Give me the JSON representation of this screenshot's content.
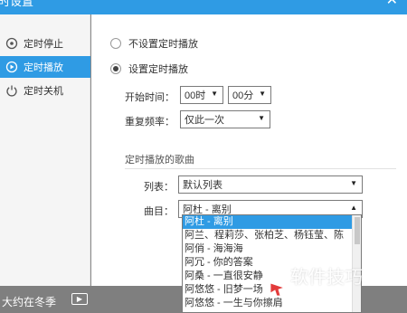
{
  "window": {
    "title": "时设置",
    "close_glyph": "✕"
  },
  "sidebar": {
    "items": [
      {
        "label": "定时停止",
        "icon": "timer-stop-icon",
        "active": false
      },
      {
        "label": "定时播放",
        "icon": "timer-play-icon",
        "active": true
      },
      {
        "label": "定时关机",
        "icon": "power-icon",
        "active": false
      }
    ]
  },
  "main": {
    "radio_no_schedule": "不设置定时播放",
    "radio_schedule": "设置定时播放",
    "start_time_label": "开始时间：",
    "hour_value": "00时",
    "minute_value": "00分",
    "repeat_label": "重复频率：",
    "repeat_value": "仅此一次",
    "section_title": "定时播放的歌曲",
    "list_label": "列表：",
    "list_value": "默认列表",
    "song_label": "曲目：",
    "song_value": "阿杜 - 离别",
    "dropdown_items": [
      "阿杜 - 离别",
      "阿兰、程莉莎、张柏芝、杨钰莹、陈",
      "阿俏 - 海海海",
      "阿冗 - 你的答案",
      "阿桑 - 一直很安静",
      "阿悠悠 - 旧梦一场",
      "阿悠悠 - 一生与你擦肩"
    ]
  },
  "player": {
    "now_playing": "大约在冬季"
  },
  "watermark": "软件技巧",
  "colors": {
    "accent": "#2f9be4",
    "sidebar_bg": "#f5f5f5",
    "bottom_bar": "#7f7f7f"
  }
}
